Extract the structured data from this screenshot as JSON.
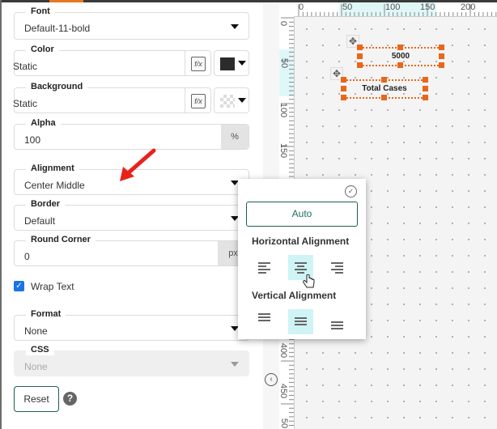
{
  "panel": {
    "font": {
      "label": "Font",
      "value": "Default-11-bold"
    },
    "color": {
      "label": "Color",
      "value": "Static",
      "fx_icon": "formula-icon",
      "swatch": "#2b2b2b"
    },
    "background": {
      "label": "Background",
      "value": "Static",
      "fx_icon": "formula-icon",
      "swatch": "transparent"
    },
    "alpha": {
      "label": "Alpha",
      "value": "100",
      "unit": "%"
    },
    "alignment": {
      "label": "Alignment",
      "value": "Center Middle"
    },
    "border": {
      "label": "Border",
      "value": "Default"
    },
    "round_corner": {
      "label": "Round Corner",
      "value": "0",
      "unit": "px"
    },
    "wrap_text": {
      "label": "Wrap Text",
      "checked": true
    },
    "format": {
      "label": "Format",
      "value": "None"
    },
    "css": {
      "label": "CSS",
      "value": "None",
      "disabled": true
    },
    "reset_label": "Reset",
    "help_glyph": "?"
  },
  "popup": {
    "auto_label": "Auto",
    "horizontal_title": "Horizontal Alignment",
    "vertical_title": "Vertical Alignment",
    "horizontal_options": [
      "left",
      "center",
      "right"
    ],
    "horizontal_selected": "center",
    "vertical_options": [
      "top",
      "middle",
      "bottom"
    ],
    "vertical_selected": "middle"
  },
  "canvas": {
    "ruler_h_labels": [
      "0",
      "50",
      "100",
      "150",
      "200"
    ],
    "ruler_v_labels": [
      "0",
      "50",
      "100",
      "150",
      "400",
      "450",
      "50"
    ],
    "elements": [
      {
        "text": "5000"
      },
      {
        "text": "Total Cases"
      }
    ]
  },
  "colors": {
    "accent": "#e8671a",
    "teal": "#1d5e55",
    "selected_bg": "#cff4f5"
  }
}
